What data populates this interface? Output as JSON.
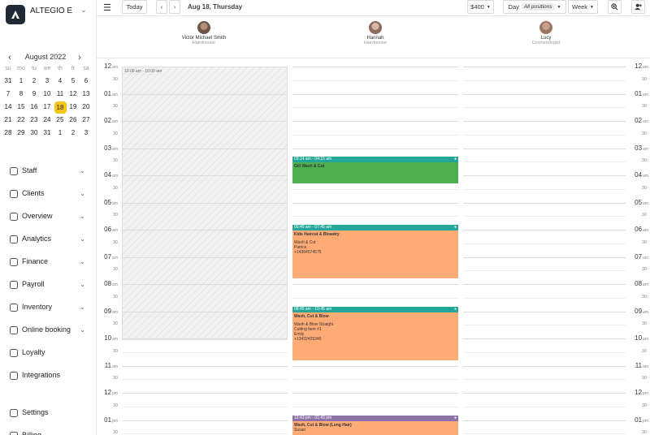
{
  "company": {
    "name": "ALTEGIO E"
  },
  "calendar": {
    "month_label": "August 2022",
    "weekdays": [
      "su",
      "mo",
      "tu",
      "we",
      "th",
      "fr",
      "sa"
    ],
    "weeks": [
      [
        "31",
        "1",
        "2",
        "3",
        "4",
        "5",
        "6"
      ],
      [
        "7",
        "8",
        "9",
        "10",
        "11",
        "12",
        "13"
      ],
      [
        "14",
        "15",
        "16",
        "17",
        "18",
        "19",
        "20"
      ],
      [
        "21",
        "22",
        "23",
        "24",
        "25",
        "26",
        "27"
      ],
      [
        "28",
        "29",
        "30",
        "31",
        "1",
        "2",
        "3"
      ]
    ],
    "selected": "18"
  },
  "nav": {
    "items": [
      {
        "label": "Staff",
        "icon": "staff-icon",
        "chevron": true
      },
      {
        "label": "Clients",
        "icon": "clients-icon",
        "chevron": true
      },
      {
        "label": "Overview",
        "icon": "overview-icon",
        "chevron": true
      },
      {
        "label": "Analytics",
        "icon": "analytics-icon",
        "chevron": true
      },
      {
        "label": "Finance",
        "icon": "finance-icon",
        "chevron": true
      },
      {
        "label": "Payroll",
        "icon": "payroll-icon",
        "chevron": true
      },
      {
        "label": "Inventory",
        "icon": "inventory-icon",
        "chevron": true
      },
      {
        "label": "Online booking",
        "icon": "online-booking-icon",
        "chevron": true
      },
      {
        "label": "Loyalty",
        "icon": "loyalty-icon",
        "chevron": false
      },
      {
        "label": "Integrations",
        "icon": "integrations-icon",
        "chevron": false
      }
    ],
    "bottom": [
      {
        "label": "Settings",
        "icon": "settings-icon",
        "chevron": false
      },
      {
        "label": "Billing",
        "icon": "billing-icon",
        "chevron": false
      }
    ]
  },
  "toolbar": {
    "today": "Today",
    "date": "Aug 18, Thursday",
    "amount": "$400",
    "view": "Day",
    "positions": "All positions",
    "week": "Week"
  },
  "staff": [
    {
      "name": "Victor Michael Smith",
      "position": "Hairdresser"
    },
    {
      "name": "Hannah",
      "position": "Hairdresser"
    },
    {
      "name": "Lucy",
      "position": "Cosmetologist"
    }
  ],
  "timeline": {
    "hours": [
      "12",
      "01",
      "02",
      "03",
      "04",
      "05",
      "06",
      "07",
      "08",
      "09",
      "10",
      "11",
      "12",
      "01"
    ],
    "suffix": [
      "am",
      "am",
      "am",
      "am",
      "am",
      "am",
      "am",
      "am",
      "am",
      "am",
      "am",
      "am",
      "pm",
      "pm"
    ],
    "half": "30"
  },
  "blocked": {
    "label": "12:00 am - 10:00 am"
  },
  "appointments": [
    {
      "time": "03:14 am - 04:15 am",
      "lines": [
        "Gill Wash & Cut"
      ],
      "header_color": "#24a79a",
      "body_color": "#4caf50"
    },
    {
      "time": "05:45 am - 07:45 am",
      "lines": [
        "Kids Haircut & Blowdry",
        "",
        "Wash & Cut",
        "Patrice",
        "+14364574575"
      ],
      "header_color": "#24a79a",
      "body_color": "#ffab76"
    },
    {
      "time": "08:45 am - 10:45 am",
      "lines": [
        "Wash, Cut & Blow",
        "",
        "Wash & Blow Straight",
        "Cutting item #1",
        "Emily",
        "+13432425345"
      ],
      "header_color": "#24a79a",
      "body_color": "#ffab76"
    },
    {
      "time": "12:43 pm - 01:43 pm",
      "lines": [
        "Wash, Cut & Blow (Long Hair)",
        "Susan"
      ],
      "header_color": "#8e74a8",
      "body_color": "#ffab76"
    }
  ]
}
